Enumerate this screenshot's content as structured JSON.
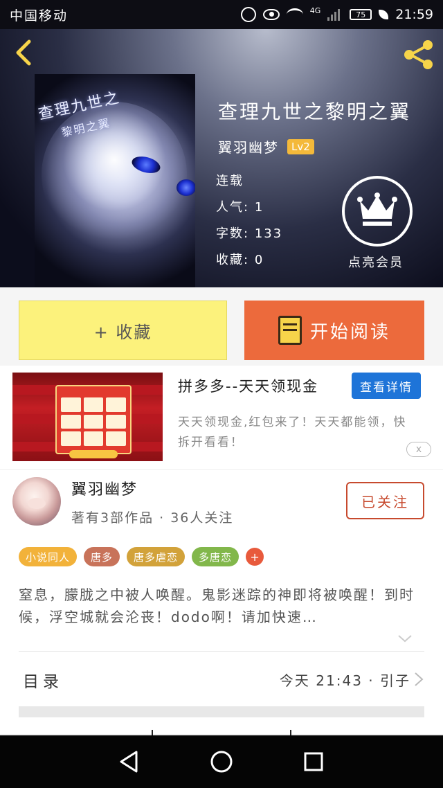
{
  "status_bar": {
    "carrier": "中国移动",
    "network": "4G",
    "battery": "75",
    "time": "21:59"
  },
  "book": {
    "title": "查理九世之黎明之翼",
    "author": "翼羽幽梦",
    "level": "Lv2",
    "status": "连载",
    "popularity_label": "人气:",
    "popularity_value": "1",
    "words_label": "字数:",
    "words_value": "133",
    "favorites_label": "收藏:",
    "favorites_value": "0",
    "cover_text_1": "查理九世之",
    "cover_text_2": "黎明之翼"
  },
  "vip": {
    "label": "点亮会员"
  },
  "actions": {
    "favorite_label": "+ 收藏",
    "read_label": "开始阅读"
  },
  "ad": {
    "title": "拼多多--天天领现金",
    "detail_button": "查看详情",
    "description": "天天领现金,红包来了！天天都能领，快拆开看看！",
    "close_icon": "x"
  },
  "author_card": {
    "name": "翼羽幽梦",
    "info": "著有3部作品 · 36人关注",
    "follow_label": "已关注"
  },
  "tags": [
    {
      "label": "小说同人",
      "color": "#f2b23a"
    },
    {
      "label": "唐多",
      "color": "#c8735a"
    },
    {
      "label": "唐多虐恋",
      "color": "#d2a23a"
    },
    {
      "label": "多唐恋",
      "color": "#82b74b"
    }
  ],
  "tag_more": "+",
  "synopsis": "窒息，朦胧之中被人唤醒。鬼影迷踪的神即将被唤醒！到时候，浮空城就会沦丧！dodo啊！请加快速…",
  "catalog": {
    "label": "目录",
    "update": "今天 21:43 · 引子"
  },
  "colors": {
    "favorite_bg": "#fcf27c",
    "read_bg": "#ec6a3c",
    "detail_bg": "#1e74d8",
    "follow_border": "#c74a2e",
    "level_bg": "#f4b93a"
  }
}
